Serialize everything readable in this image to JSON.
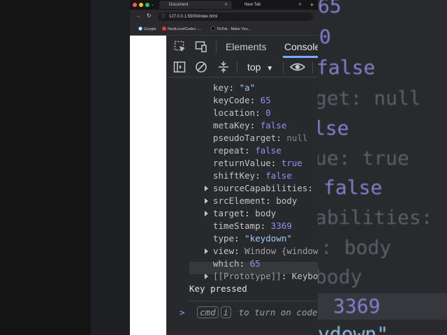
{
  "browser": {
    "tabs": [
      {
        "label": "Document",
        "active": true
      },
      {
        "label": "New Tab",
        "active": false
      }
    ],
    "new_tab_symbol": "+",
    "address": "127.0.0.1:5500/index.html",
    "bookmarks": [
      {
        "label": "Google",
        "color": "#4285f4"
      },
      {
        "label": "NextLevelCodes -...",
        "color": "#e53935"
      },
      {
        "label": "TikTok - Make You...",
        "color": "#111111"
      }
    ]
  },
  "devtools": {
    "tabs": [
      "Elements",
      "Console"
    ],
    "active_tab": "Console",
    "context": "top"
  },
  "console": {
    "properties": [
      {
        "key": "key",
        "value": "\"a\"",
        "type": "str",
        "expandable": false
      },
      {
        "key": "keyCode",
        "value": "65",
        "type": "num",
        "expandable": false
      },
      {
        "key": "location",
        "value": "0",
        "type": "num",
        "expandable": false
      },
      {
        "key": "metaKey",
        "value": "false",
        "type": "bool",
        "expandable": false
      },
      {
        "key": "pseudoTarget",
        "value": "null",
        "type": "nul",
        "expandable": false
      },
      {
        "key": "repeat",
        "value": "false",
        "type": "bool",
        "expandable": false
      },
      {
        "key": "returnValue",
        "value": "true",
        "type": "bool",
        "expandable": false
      },
      {
        "key": "shiftKey",
        "value": "false",
        "type": "bool",
        "expandable": false
      },
      {
        "key": "sourceCapabilities",
        "value": "",
        "type": "obj",
        "expandable": true
      },
      {
        "key": "srcElement",
        "value": "body",
        "type": "obj",
        "expandable": true
      },
      {
        "key": "target",
        "value": "body",
        "type": "obj",
        "expandable": true
      },
      {
        "key": "timeStamp",
        "value": "3369",
        "type": "num",
        "expandable": false
      },
      {
        "key": "type",
        "value": "\"keydown\"",
        "type": "str",
        "expandable": false
      },
      {
        "key": "view",
        "value": "Window {window",
        "type": "dim",
        "expandable": true
      },
      {
        "key": "which",
        "value": "65",
        "type": "num",
        "expandable": false
      },
      {
        "key": "[[Prototype]]",
        "value": "Keybo",
        "type": "obj",
        "expandable": true
      }
    ],
    "log_message": "Key pressed",
    "prompt_chevron": ">",
    "kbd_cmd": "cmd",
    "kbd_i": "i",
    "hint": "to turn on code"
  },
  "backdrop": {
    "lines": [
      {
        "text": "65"
      },
      {
        "text": "0"
      },
      {
        "text": "false"
      },
      {
        "text": "get: null"
      },
      {
        "text": "lse"
      },
      {
        "text": "ue: true"
      },
      {
        "text": "false"
      },
      {
        "text": "abilities:"
      },
      {
        "text": ": body"
      },
      {
        "text": "body"
      },
      {
        "text": "3369"
      },
      {
        "text": "ydown\""
      }
    ]
  }
}
